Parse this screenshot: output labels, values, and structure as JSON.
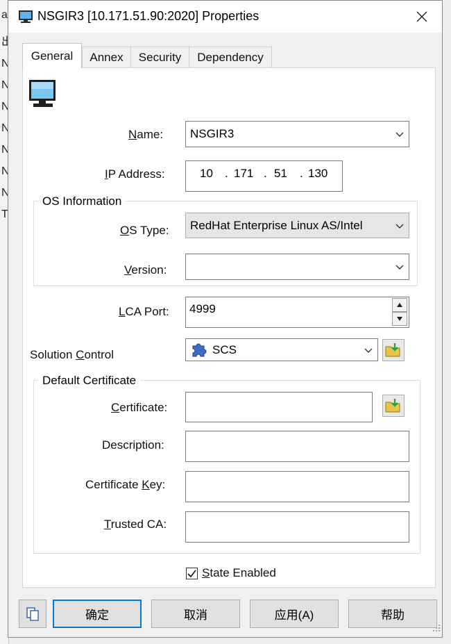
{
  "window": {
    "title": "NSGIR3 [10.171.51.90:2020] Properties"
  },
  "background_rows": [
    "ar",
    "出",
    "N",
    "N",
    "N",
    "N",
    "N",
    "N",
    "N",
    "T"
  ],
  "tabs": [
    {
      "label": "General",
      "active": true
    },
    {
      "label": "Annex",
      "active": false
    },
    {
      "label": "Security",
      "active": false
    },
    {
      "label": "Dependency",
      "active": false
    }
  ],
  "general": {
    "name": {
      "label_pre": "",
      "label_key": "N",
      "label_post": "ame:",
      "value": "NSGIR3"
    },
    "ip": {
      "label_pre": "",
      "label_key": "I",
      "label_post": "P Address:",
      "octets": [
        "10",
        "171",
        "51",
        "130"
      ],
      "sep": "."
    },
    "os_group": {
      "title": "OS Information",
      "os_type": {
        "label_pre": "",
        "label_key": "O",
        "label_post": "S Type:",
        "value": "RedHat Enterprise Linux AS/Intel"
      },
      "version": {
        "label_pre": "",
        "label_key": "V",
        "label_post": "ersion:",
        "value": ""
      }
    },
    "lca_port": {
      "label_pre": "",
      "label_key": "L",
      "label_post": "CA Port:",
      "value": "4999"
    },
    "solution_control": {
      "label_pre": "Solution ",
      "label_key": "C",
      "label_post": "ontrol",
      "value": "SCS"
    },
    "cert_group": {
      "title": "Default Certificate",
      "certificate": {
        "label_pre": "",
        "label_key": "C",
        "label_post": "ertificate:",
        "value": ""
      },
      "description": {
        "label": "Description:",
        "value": ""
      },
      "certificate_key": {
        "label_pre": "Certificate ",
        "label_key": "K",
        "label_post": "ey:",
        "value": ""
      },
      "trusted_ca": {
        "label_pre": "",
        "label_key": "T",
        "label_post": "rusted CA:",
        "value": ""
      }
    },
    "state": {
      "label_pre": "",
      "label_key": "S",
      "label_post": "tate Enabled",
      "checked": true
    }
  },
  "footer": {
    "ok": "确定",
    "cancel": "取消",
    "apply": "应用(A)",
    "help": "帮助"
  },
  "colors": {
    "accent": "#0078d7",
    "folder": "#e8c34a",
    "arrow": "#2fa33a",
    "puzzle": "#3a6fc4"
  }
}
